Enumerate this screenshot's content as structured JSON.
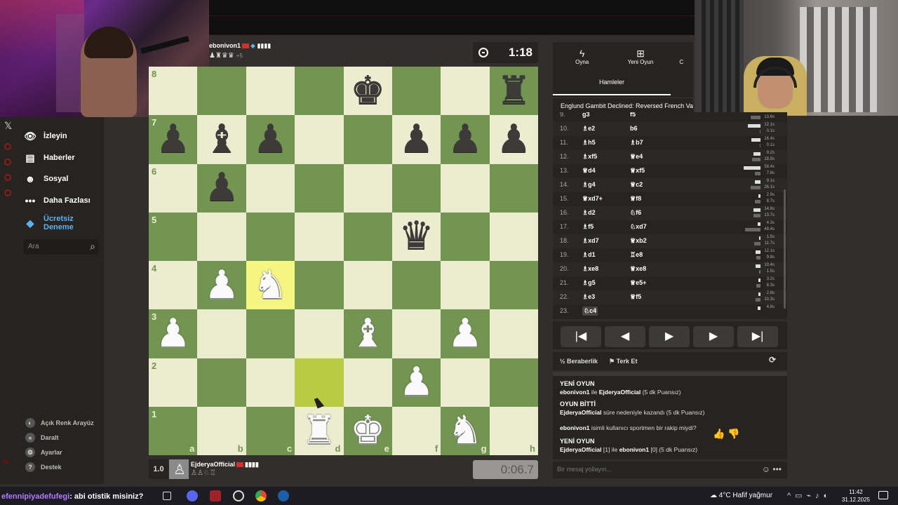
{
  "opponent": {
    "name": "ebonivon1",
    "captured": "♟♜♛♛",
    "material_diff": "+5",
    "clock": "1:18"
  },
  "player": {
    "rating_badge": "1.0",
    "name": "EjderyaOfficial",
    "captured": "♙♙♘♖",
    "clock": "0:06.7"
  },
  "sidebar": {
    "items": [
      {
        "label": "İzleyin",
        "icon": "binoculars-icon"
      },
      {
        "label": "Haberler",
        "icon": "news-icon"
      },
      {
        "label": "Sosyal",
        "icon": "social-icon"
      },
      {
        "label": "Daha Fazlası",
        "icon": "more-icon"
      }
    ],
    "trial_line1": "Ücretsiz",
    "trial_line2": "Deneme",
    "search_placeholder": "Ara",
    "bottom": [
      {
        "label": "Açık Renk Arayüz"
      },
      {
        "label": "Daralt"
      },
      {
        "label": "Ayarlar"
      },
      {
        "label": "Destek"
      }
    ],
    "badge": "6K"
  },
  "panel": {
    "tabs": [
      {
        "label": "Oyna",
        "icon": "bolt-icon"
      },
      {
        "label": "Yeni Oyun",
        "icon": "plus-icon"
      },
      {
        "label": "C",
        "icon": "more-icon"
      }
    ],
    "section_tab": "Hamleler",
    "opening": "Englund Gambit Declined: Reversed French Variat"
  },
  "moves": [
    {
      "num": "9.",
      "w": "g3",
      "b": "f5",
      "tw": "",
      "tb": "13.6s",
      "ww": 0,
      "wb": 14
    },
    {
      "num": "10.",
      "w": "♗e2",
      "b": "b6",
      "tw": "12.1s",
      "tb": "0.1s",
      "ww": 18,
      "wb": 1
    },
    {
      "num": "11.",
      "w": "♗h5",
      "b": "♗b7",
      "tw": "16.4s",
      "tb": "0.1s",
      "ww": 13,
      "wb": 1
    },
    {
      "num": "12.",
      "w": "♗xf5",
      "b": "♕e4",
      "tw": "9.2s",
      "tb": "18.9s",
      "ww": 10,
      "wb": 12
    },
    {
      "num": "13.",
      "w": "♕d4",
      "b": "♕xf5",
      "tw": "58.4s",
      "tb": "7.8s",
      "ww": 24,
      "wb": 8
    },
    {
      "num": "14.",
      "w": "♗g4",
      "b": "♕c2",
      "tw": "9.1s",
      "tb": "26.1s",
      "ww": 8,
      "wb": 14
    },
    {
      "num": "15.",
      "w": "♕xd7+",
      "b": "♕f8",
      "tw": "2.9s",
      "tb": "8.7s",
      "ww": 3,
      "wb": 8
    },
    {
      "num": "16.",
      "w": "♗d2",
      "b": "♘f6",
      "tw": "14.6s",
      "tb": "13.7s",
      "ww": 10,
      "wb": 10
    },
    {
      "num": "17.",
      "w": "♗f5",
      "b": "♘xd7",
      "tw": "4.3s",
      "tb": "48.4s",
      "ww": 4,
      "wb": 22
    },
    {
      "num": "18.",
      "w": "♗xd7",
      "b": "♕xb2",
      "tw": "1.5s",
      "tb": "11.7s",
      "ww": 2,
      "wb": 9
    },
    {
      "num": "19.",
      "w": "♗d1",
      "b": "♖e8",
      "tw": "12.1s",
      "tb": "9.8s",
      "ww": 7,
      "wb": 6
    },
    {
      "num": "20.",
      "w": "♗xe8",
      "b": "♕xe8",
      "tw": "10.4s",
      "tb": "1.5s",
      "ww": 7,
      "wb": 2
    },
    {
      "num": "21.",
      "w": "♗g5",
      "b": "♕e5+",
      "tw": "3.2s",
      "tb": "8.3s",
      "ww": 3,
      "wb": 6
    },
    {
      "num": "22.",
      "w": "♗e3",
      "b": "♕f5",
      "tw": "2.8s",
      "tb": "10.3s",
      "ww": 3,
      "wb": 7
    },
    {
      "num": "23.",
      "w": "♘c4",
      "b": "",
      "tw": "4.8s",
      "tb": "",
      "ww": 4,
      "wb": 0
    }
  ],
  "nav_buttons": [
    "|◀",
    "◀",
    "▶",
    "▶",
    "▶|"
  ],
  "actions": {
    "draw": "Beraberlik",
    "resign": "Terk Et",
    "draw_icon": "½"
  },
  "chat": {
    "l1": "YENİ OYUN",
    "l2a": "ebonivon1",
    "l2b": " ile ",
    "l2c": "EjderyaOfficial",
    "l2d": " (5 dk Puansız)",
    "l3": "OYUN BİTTİ",
    "l4a": "EjderyaOfficial",
    "l4b": " süre nedeniyle kazandı (5 dk Puansız)",
    "l5a": "ebonivon1",
    "l5b": " isimli kullanıcı sportmen bir rakip miydi?",
    "l6": "YENİ OYUN",
    "l7a": "EjderyaOfficial",
    "l7b": " [1] ile ",
    "l7c": "ebonivon1",
    "l7d": " [0] (5 dk Puansız)",
    "placeholder": "Bir mesaj yollayın..."
  },
  "taskbar": {
    "chat_user": "efennipiyadefufegi",
    "chat_msg": ": abi otistik misiniz?",
    "weather": "4°C  Hafif yağmur",
    "time": "11:42",
    "date": "31.12.2025"
  },
  "board": {
    "ranks": [
      "8",
      "7",
      "6",
      "5",
      "4",
      "3",
      "2",
      "1"
    ],
    "files": [
      "a",
      "b",
      "c",
      "d",
      "e",
      "f",
      "g",
      "h"
    ],
    "pieces": {
      "e8": "bk",
      "h8": "br",
      "a7": "bp",
      "b7": "bb",
      "c7": "bp",
      "f7": "bp",
      "g7": "bp",
      "h7": "bp",
      "b6": "bp",
      "f5": "bq",
      "b4": "wp",
      "c4": "wn",
      "a3": "wp",
      "e3": "wb",
      "g3": "wp",
      "f2": "wp",
      "d1": "wr",
      "e1": "wk",
      "g1": "wn"
    },
    "highlight": [
      "c4",
      "d2"
    ]
  }
}
